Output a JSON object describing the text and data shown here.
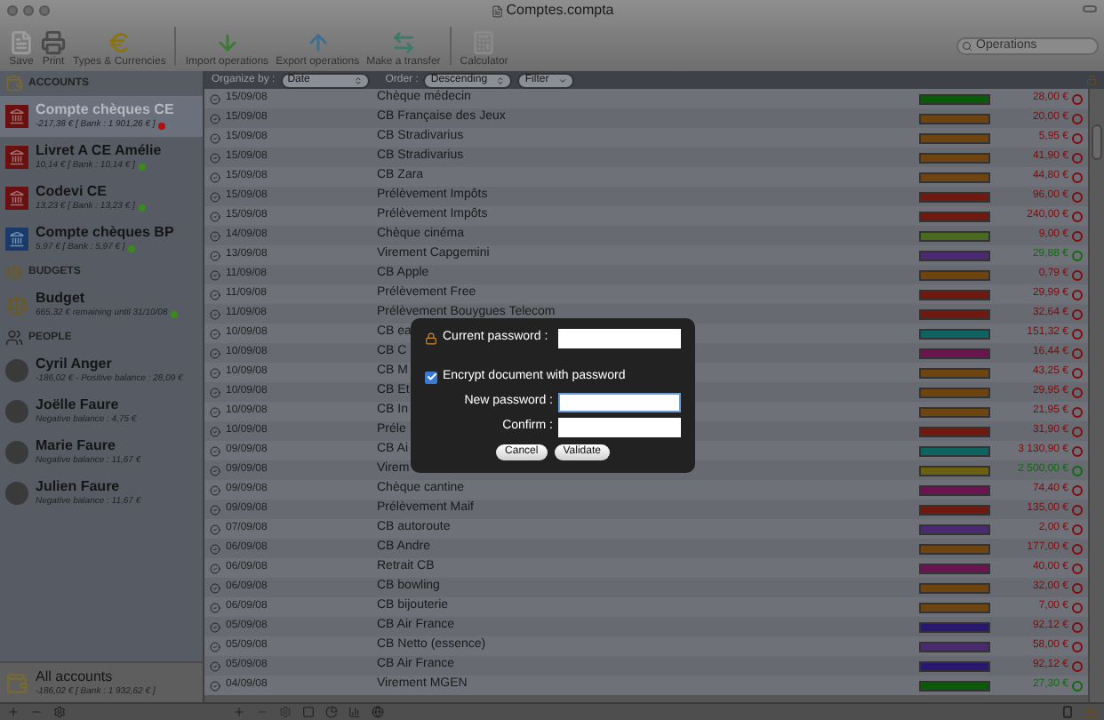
{
  "window": {
    "title": "Comptes.compta"
  },
  "toolbar": [
    {
      "label": "Save",
      "kind": "save"
    },
    {
      "label": "Print",
      "kind": "print"
    },
    {
      "label": "Types & Currencies",
      "kind": "currency"
    },
    {
      "label": "Import operations",
      "kind": "import"
    },
    {
      "label": "Export operations",
      "kind": "export"
    },
    {
      "label": "Make a transfer",
      "kind": "transfer"
    },
    {
      "label": "Calculator",
      "kind": "calculator"
    }
  ],
  "search": {
    "placeholder": "Operations"
  },
  "sidebar": {
    "sections": [
      {
        "title": "ACCOUNTS",
        "kind": "accounts",
        "items": [
          {
            "name": "Compte chèques CE",
            "detail": "-217,38 € [ Bank : 1 901,26 € ]",
            "kind": "bank-red",
            "selected": true,
            "color": "#b01010"
          },
          {
            "name": "Livret A CE Amélie",
            "detail": "10,14 € [ Bank : 10,14 € ]",
            "kind": "bank-red",
            "selected": false,
            "color": "#3c8a1c"
          },
          {
            "name": "Codevi CE",
            "detail": "13,23 € [ Bank : 13,23 € ]",
            "kind": "bank-red",
            "selected": false,
            "color": "#3c8a1c"
          },
          {
            "name": "Compte chèques BP",
            "detail": "5,97 € [ Bank : 5,97 € ]",
            "kind": "bank-blue",
            "selected": false,
            "color": "#3c8a1c"
          }
        ]
      },
      {
        "title": "BUDGETS",
        "kind": "budgets",
        "items": [
          {
            "name": "Budget",
            "detail": "665,32 € remaining until 31/10/08",
            "kind": "scale",
            "selected": false,
            "color": "#3c8a1c"
          }
        ]
      },
      {
        "title": "PEOPLE",
        "kind": "people",
        "items": [
          {
            "name": "Cyril Anger",
            "detail": "-186,02 € - Positive balance : 28,09 €",
            "kind": "person",
            "selected": false
          },
          {
            "name": "Joëlle Faure",
            "detail": "Negative balance : 4,75 €",
            "kind": "person",
            "selected": false
          },
          {
            "name": "Marie Faure",
            "detail": "Negative balance : 11,67 €",
            "kind": "person",
            "selected": false
          },
          {
            "name": "Julien Faure",
            "detail": "Negative balance : 11,67 €",
            "kind": "person",
            "selected": false
          }
        ]
      }
    ],
    "footer": {
      "name": "All accounts",
      "detail": "-186,02 € [ Bank : 1 932,62 € ]"
    }
  },
  "list_header": {
    "organize_label": "Organize by :",
    "organize_value": "Date",
    "order_label": "Order :",
    "order_value": "Descending",
    "filter": "Filter"
  },
  "rows": [
    {
      "date": "15/09/08",
      "description": "Chèque médecin",
      "color": "#0a5a0a",
      "amount": "28,00 €",
      "kind": "debit"
    },
    {
      "date": "15/09/08",
      "description": "CB Française des Jeux",
      "color": "#6e4410",
      "amount": "20,00 €",
      "kind": "debit"
    },
    {
      "date": "15/09/08",
      "description": "CB Stradivarius",
      "color": "#6e4410",
      "amount": "5,95 €",
      "kind": "debit"
    },
    {
      "date": "15/09/08",
      "description": "CB Stradivarius",
      "color": "#6e4410",
      "amount": "41,90 €",
      "kind": "debit"
    },
    {
      "date": "15/09/08",
      "description": "CB Zara",
      "color": "#6e4410",
      "amount": "44,80 €",
      "kind": "debit"
    },
    {
      "date": "15/09/08",
      "description": "Prélèvement Impôts",
      "color": "#6e1a10",
      "amount": "96,00 €",
      "kind": "debit"
    },
    {
      "date": "15/09/08",
      "description": "Prélèvement Impôts",
      "color": "#6e1a10",
      "amount": "240,00 €",
      "kind": "debit"
    },
    {
      "date": "14/09/08",
      "description": "Chèque cinéma",
      "color": "#4a6a22",
      "amount": "9,00 €",
      "kind": "debit"
    },
    {
      "date": "13/09/08",
      "description": "Virement Capgemini",
      "color": "#4a2a70",
      "amount": "29,88 €",
      "kind": "credit"
    },
    {
      "date": "11/09/08",
      "description": "CB Apple",
      "color": "#6e4410",
      "amount": "0,79 €",
      "kind": "debit"
    },
    {
      "date": "11/09/08",
      "description": "Prélèvement Free",
      "color": "#6e1a10",
      "amount": "29,99 €",
      "kind": "debit"
    },
    {
      "date": "11/09/08",
      "description": "Prélèvement Bouygues Telecom",
      "color": "#6e1a10",
      "amount": "32,64 €",
      "kind": "debit"
    },
    {
      "date": "10/09/08",
      "description": "CB ea",
      "color": "#0e6460",
      "amount": "151,32 €",
      "kind": "debit"
    },
    {
      "date": "10/09/08",
      "description": "CB C",
      "color": "#6a1450",
      "amount": "16,44 €",
      "kind": "debit"
    },
    {
      "date": "10/09/08",
      "description": "CB M",
      "color": "#6e4410",
      "amount": "43,25 €",
      "kind": "debit"
    },
    {
      "date": "10/09/08",
      "description": "CB Et",
      "color": "#6e4410",
      "amount": "29,95 €",
      "kind": "debit"
    },
    {
      "date": "10/09/08",
      "description": "CB In",
      "color": "#6e4410",
      "amount": "21,95 €",
      "kind": "debit"
    },
    {
      "date": "10/09/08",
      "description": "Préle",
      "color": "#6e1a10",
      "amount": "31,90 €",
      "kind": "debit"
    },
    {
      "date": "09/09/08",
      "description": "CB Ai",
      "color": "#0e6460",
      "amount": "3 130,90 €",
      "kind": "debit"
    },
    {
      "date": "09/09/08",
      "description": "Virem",
      "color": "#6a6010",
      "amount": "2 500,00 €",
      "kind": "credit"
    },
    {
      "date": "09/09/08",
      "description": "Chèque cantine",
      "color": "#6a1450",
      "amount": "74,40 €",
      "kind": "debit"
    },
    {
      "date": "09/09/08",
      "description": "Prélèvement Maif",
      "color": "#6e1a10",
      "amount": "135,00 €",
      "kind": "debit"
    },
    {
      "date": "07/09/08",
      "description": "CB autoroute",
      "color": "#4a2a70",
      "amount": "2,00 €",
      "kind": "debit"
    },
    {
      "date": "06/09/08",
      "description": "CB Andre",
      "color": "#6e4410",
      "amount": "177,00 €",
      "kind": "debit"
    },
    {
      "date": "06/09/08",
      "description": "Retrait CB",
      "color": "#6a1450",
      "amount": "40,00 €",
      "kind": "debit"
    },
    {
      "date": "06/09/08",
      "description": "CB bowling",
      "color": "#6e4410",
      "amount": "32,00 €",
      "kind": "debit"
    },
    {
      "date": "06/09/08",
      "description": "CB bijouterie",
      "color": "#6e4410",
      "amount": "7,00 €",
      "kind": "debit"
    },
    {
      "date": "05/09/08",
      "description": "CB Air France",
      "color": "#2a1870",
      "amount": "92,12 €",
      "kind": "debit"
    },
    {
      "date": "05/09/08",
      "description": "CB Netto (essence)",
      "color": "#4a2a70",
      "amount": "58,00 €",
      "kind": "debit"
    },
    {
      "date": "05/09/08",
      "description": "CB Air France",
      "color": "#2a1870",
      "amount": "92,12 €",
      "kind": "debit"
    },
    {
      "date": "04/09/08",
      "description": "Virement MGEN",
      "color": "#0a5a0a",
      "amount": "27,30 €",
      "kind": "credit"
    }
  ],
  "dialog": {
    "current_password_label": "Current password :",
    "encrypt": {
      "label": "Encrypt document with password",
      "checked": true
    },
    "new_password_label": "New password :",
    "confirm_label": "Confirm :",
    "buttons": [
      "Cancel",
      "Validate"
    ]
  }
}
